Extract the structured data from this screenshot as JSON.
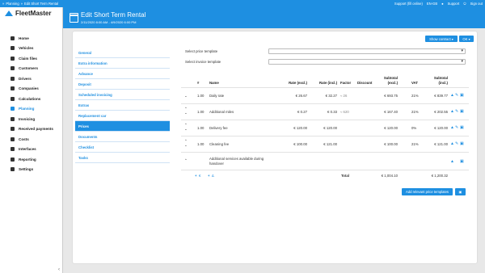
{
  "topbar": {
    "breadcrumb": [
      "Planning",
      "Edit Short Term Rental"
    ],
    "support": "Support (fill online)",
    "language": "EN-GB",
    "help": "Support",
    "signout": "Sign out"
  },
  "brand": {
    "name": "FleetMaster"
  },
  "menu": [
    {
      "label": "Home"
    },
    {
      "label": "Vehicles"
    },
    {
      "label": "Claim files"
    },
    {
      "label": "Customers"
    },
    {
      "label": "Drivers"
    },
    {
      "label": "Companies"
    },
    {
      "label": "Calculations"
    },
    {
      "label": "Planning"
    },
    {
      "label": "Invoicing"
    },
    {
      "label": "Received payments"
    },
    {
      "label": "Costs"
    },
    {
      "label": "Interfaces"
    },
    {
      "label": "Reporting"
    },
    {
      "label": "Settings"
    }
  ],
  "header": {
    "title": "Edit Short Term Rental",
    "subtitle": "2/11/2020 8:00 AM - 4/9/2020 6:00 PM"
  },
  "actions": {
    "show_contract": "Show contract",
    "ok": "OK"
  },
  "tabs": [
    {
      "label": "General"
    },
    {
      "label": "Extra information"
    },
    {
      "label": "Advance"
    },
    {
      "label": "Deposit"
    },
    {
      "label": "Scheduled invoicing"
    },
    {
      "label": "Extras"
    },
    {
      "label": "Replacement car"
    },
    {
      "label": "Prices"
    },
    {
      "label": "Documents"
    },
    {
      "label": "Checklist"
    },
    {
      "label": "Tasks"
    }
  ],
  "form": {
    "price_template_label": "Select price template",
    "invoice_template_label": "Select invoice template"
  },
  "table": {
    "headers": [
      "#",
      "Name",
      "Rate (excl.)",
      "Rate (incl.)",
      "Factor",
      "Discount",
      "Subtotal (excl.)",
      "VAT",
      "Subtotal (incl.)"
    ],
    "rows": [
      {
        "qty": "1.00",
        "name": "Daily rate",
        "rate_excl": "€ 26.67",
        "rate_incl": "€ 32.27",
        "factor": "≈ 26",
        "discount": "",
        "sub_excl": "€ 693.75",
        "vat": "21%",
        "sub_incl": "€ 839.77"
      },
      {
        "qty": "1.00",
        "name": "Additional miles",
        "rate_excl": "€ 0.27",
        "rate_incl": "€ 0.33",
        "factor": "≈ 620",
        "discount": "",
        "sub_excl": "€ 167.40",
        "vat": "21%",
        "sub_incl": "€ 202.55"
      },
      {
        "qty": "1.00",
        "name": "Delivery fee",
        "rate_excl": "€ 120.00",
        "rate_incl": "€ 120.00",
        "factor": "",
        "discount": "",
        "sub_excl": "€ 120.00",
        "vat": "0%",
        "sub_incl": "€ 120.00"
      },
      {
        "qty": "1.00",
        "name": "Cleaning fee",
        "rate_excl": "€ 100.00",
        "rate_incl": "€ 121.00",
        "factor": "",
        "discount": "",
        "sub_excl": "€ 100.00",
        "vat": "21%",
        "sub_incl": "€ 121.00"
      }
    ],
    "additional_services": "Additional services available during handover",
    "footer_links": [
      "€",
      "∆"
    ],
    "total_label": "Total",
    "total_excl": "€ 1,004.10",
    "total_incl": "€ 1,200.32"
  },
  "add_templates": "Add relevant price templates"
}
